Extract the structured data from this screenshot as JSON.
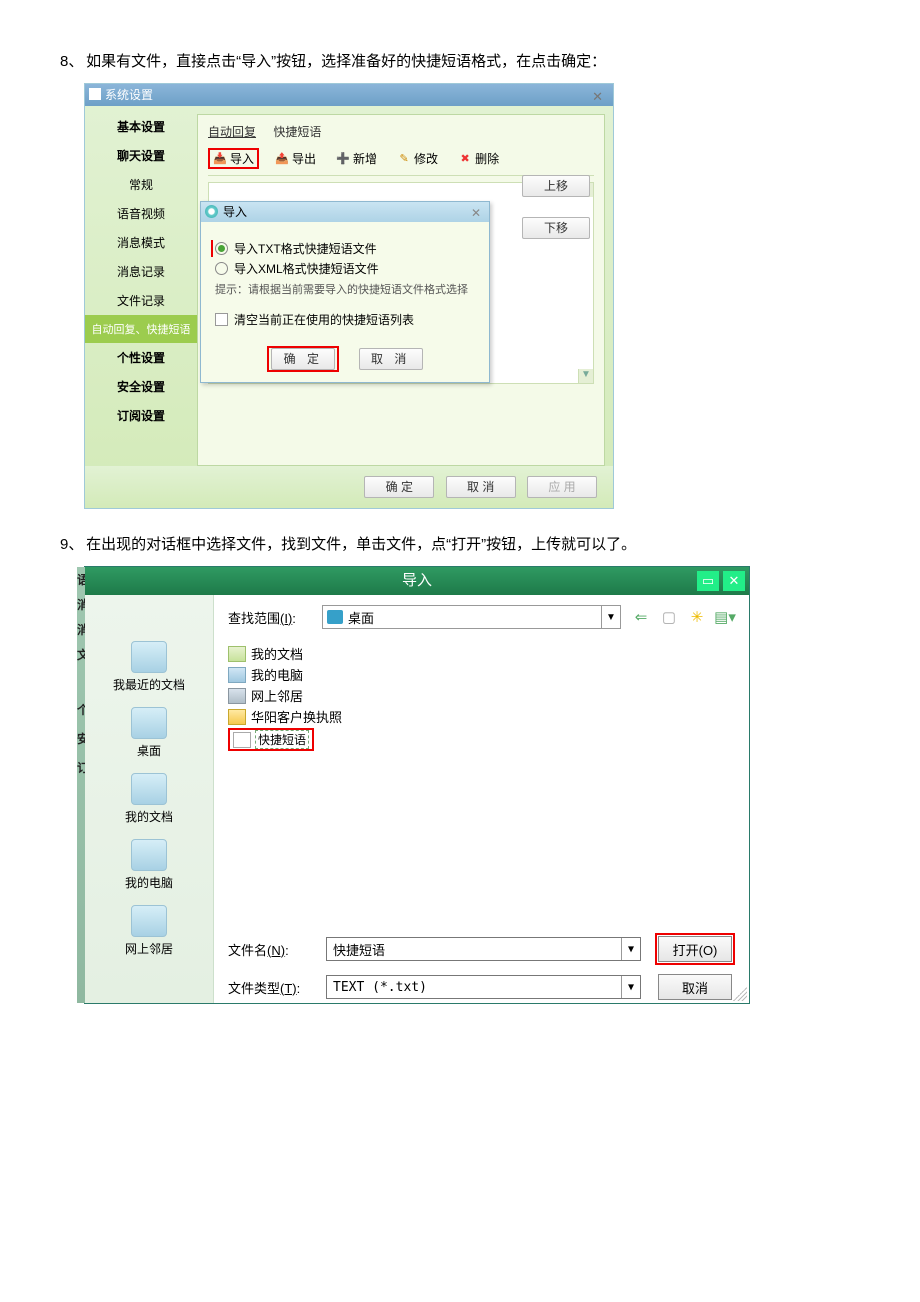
{
  "step8": "如果有文件，直接点击“导入”按钮，选择准备好的快捷短语格式，在点击确定：",
  "step9": "在出现的对话框中选择文件，找到文件，单击文件，点“打开”按钮，上传就可以了。",
  "num8": "8、",
  "num9": "9、",
  "win1": {
    "title": "系统设置",
    "sidebar": {
      "groups": [
        {
          "label": "基本设置",
          "type": "head"
        },
        {
          "label": "聊天设置",
          "type": "head"
        },
        {
          "label": "常规"
        },
        {
          "label": "语音视频"
        },
        {
          "label": "消息模式"
        },
        {
          "label": "消息记录"
        },
        {
          "label": "文件记录"
        },
        {
          "label": "自动回复、快捷短语",
          "type": "selected"
        },
        {
          "label": "个性设置",
          "type": "head"
        },
        {
          "label": "安全设置",
          "type": "head"
        },
        {
          "label": "订阅设置",
          "type": "head"
        }
      ]
    },
    "tabs": {
      "auto_reply": "自动回复",
      "quick_phrase": "快捷短语"
    },
    "toolbar": {
      "import": "导入",
      "export": "导出",
      "add": "新增",
      "edit": "修改",
      "delete": "删除"
    },
    "sidebuttons": {
      "move_up": "上移",
      "move_down": "下移"
    },
    "footer": {
      "ok": "确 定",
      "cancel": "取 消",
      "apply": "应 用"
    }
  },
  "popup1": {
    "title": "导入",
    "opt_txt": "导入TXT格式快捷短语文件",
    "opt_xml": "导入XML格式快捷短语文件",
    "hint": "提示：请根据当前需要导入的快捷短语文件格式选择",
    "clear": "清空当前正在使用的快捷短语列表",
    "ok": "确 定",
    "cancel": "取 消"
  },
  "win2": {
    "title": "导入",
    "look_in_label": "查找范围",
    "look_in_key": "(I)",
    "look_in_value": "桌面",
    "places": [
      {
        "label": "我最近的文档"
      },
      {
        "label": "桌面"
      },
      {
        "label": "我的文档"
      },
      {
        "label": "我的电脑"
      },
      {
        "label": "网上邻居"
      }
    ],
    "files": [
      {
        "icon": "doc",
        "label": "我的文档"
      },
      {
        "icon": "pc",
        "label": "我的电脑"
      },
      {
        "icon": "net",
        "label": "网上邻居"
      },
      {
        "icon": "folder",
        "label": "华阳客户换执照"
      },
      {
        "icon": "txt",
        "label": "快捷短语",
        "selected": true
      }
    ],
    "filename_label": "文件名",
    "filename_key": "(N)",
    "filename_value": "快捷短语",
    "filetype_label": "文件类型",
    "filetype_key": "(T)",
    "filetype_value": "TEXT (*.txt)",
    "open": "打开(O)",
    "cancel": "取消"
  }
}
